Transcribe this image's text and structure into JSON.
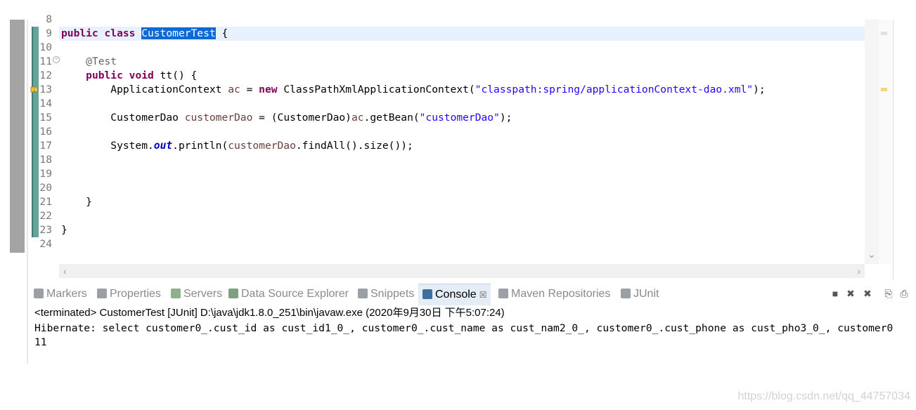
{
  "editor": {
    "lines": [
      {
        "num": "8",
        "tokens": []
      },
      {
        "num": "9",
        "tokens": [
          [
            "kw",
            "public class "
          ],
          [
            "sel",
            "CustomerTest"
          ],
          [
            "plain",
            " {"
          ]
        ]
      },
      {
        "num": "10",
        "tokens": []
      },
      {
        "num": "11",
        "tokens": [
          [
            "plain",
            "    "
          ],
          [
            "ann",
            "@Test"
          ]
        ]
      },
      {
        "num": "12",
        "tokens": [
          [
            "plain",
            "    "
          ],
          [
            "kw",
            "public void "
          ],
          [
            "plain",
            "tt() {"
          ]
        ]
      },
      {
        "num": "13",
        "tokens": [
          [
            "plain",
            "        ApplicationContext "
          ],
          [
            "var",
            "ac"
          ],
          [
            "plain",
            " = "
          ],
          [
            "kw",
            "new "
          ],
          [
            "plain",
            "ClassPathXmlApplicationContext("
          ],
          [
            "str",
            "\"classpath:spring/applicationContext-dao.xml\""
          ],
          [
            "plain",
            ");"
          ]
        ]
      },
      {
        "num": "14",
        "tokens": []
      },
      {
        "num": "15",
        "tokens": [
          [
            "plain",
            "        CustomerDao "
          ],
          [
            "var",
            "customerDao"
          ],
          [
            "plain",
            " = (CustomerDao)"
          ],
          [
            "var",
            "ac"
          ],
          [
            "plain",
            ".getBean("
          ],
          [
            "str",
            "\"customerDao\""
          ],
          [
            "plain",
            ");"
          ]
        ]
      },
      {
        "num": "16",
        "tokens": []
      },
      {
        "num": "17",
        "tokens": [
          [
            "plain",
            "        System."
          ],
          [
            "field",
            "out"
          ],
          [
            "plain",
            ".println("
          ],
          [
            "var",
            "customerDao"
          ],
          [
            "plain",
            ".findAll().size());"
          ]
        ]
      },
      {
        "num": "18",
        "tokens": []
      },
      {
        "num": "19",
        "tokens": []
      },
      {
        "num": "20",
        "tokens": []
      },
      {
        "num": "21",
        "tokens": [
          [
            "plain",
            "    }"
          ]
        ]
      },
      {
        "num": "22",
        "tokens": []
      },
      {
        "num": "23",
        "tokens": [
          [
            "plain",
            "}"
          ]
        ]
      },
      {
        "num": "24",
        "tokens": []
      }
    ],
    "fold_marker_glyph": "−",
    "hscroll_left": "‹",
    "hscroll_right": "›",
    "vscroll_down": "⌄"
  },
  "views": {
    "tabs": [
      {
        "name": "markers",
        "label": "Markers",
        "icon": "markers-icon"
      },
      {
        "name": "properties",
        "label": "Properties",
        "icon": "properties-icon"
      },
      {
        "name": "servers",
        "label": "Servers",
        "icon": "servers-icon"
      },
      {
        "name": "data-source-explorer",
        "label": "Data Source Explorer",
        "icon": "data-source-icon"
      },
      {
        "name": "snippets",
        "label": "Snippets",
        "icon": "snippets-icon"
      },
      {
        "name": "console",
        "label": "Console",
        "icon": "console-icon",
        "active": true,
        "close": "☒"
      },
      {
        "name": "maven-repositories",
        "label": "Maven Repositories",
        "icon": "maven-icon"
      },
      {
        "name": "junit",
        "label": "JUnit",
        "icon": "junit-icon"
      }
    ],
    "tools": [
      {
        "name": "terminate-icon",
        "glyph": "■"
      },
      {
        "name": "remove-launch-icon",
        "glyph": "✖"
      },
      {
        "name": "remove-all-icon",
        "glyph": "✖"
      },
      {
        "name": "clear-console-icon",
        "glyph": "⎘"
      },
      {
        "name": "scroll-lock-icon",
        "glyph": "⎙"
      }
    ]
  },
  "console": {
    "status": "<terminated> CustomerTest [JUnit] D:\\java\\jdk1.8.0_251\\bin\\javaw.exe (2020年9月30日 下午5:07:24)",
    "output": [
      "Hibernate: select customer0_.cust_id as cust_id1_0_, customer0_.cust_name as cust_nam2_0_, customer0_.cust_phone as cust_pho3_0_, customer0",
      "11"
    ]
  },
  "watermark": "https://blog.csdn.net/qq_44757034",
  "colors": {
    "keyword": "#7f0055",
    "string": "#2a00ff",
    "selection": "#0b6ad6",
    "change_bar": "#66a39a"
  }
}
